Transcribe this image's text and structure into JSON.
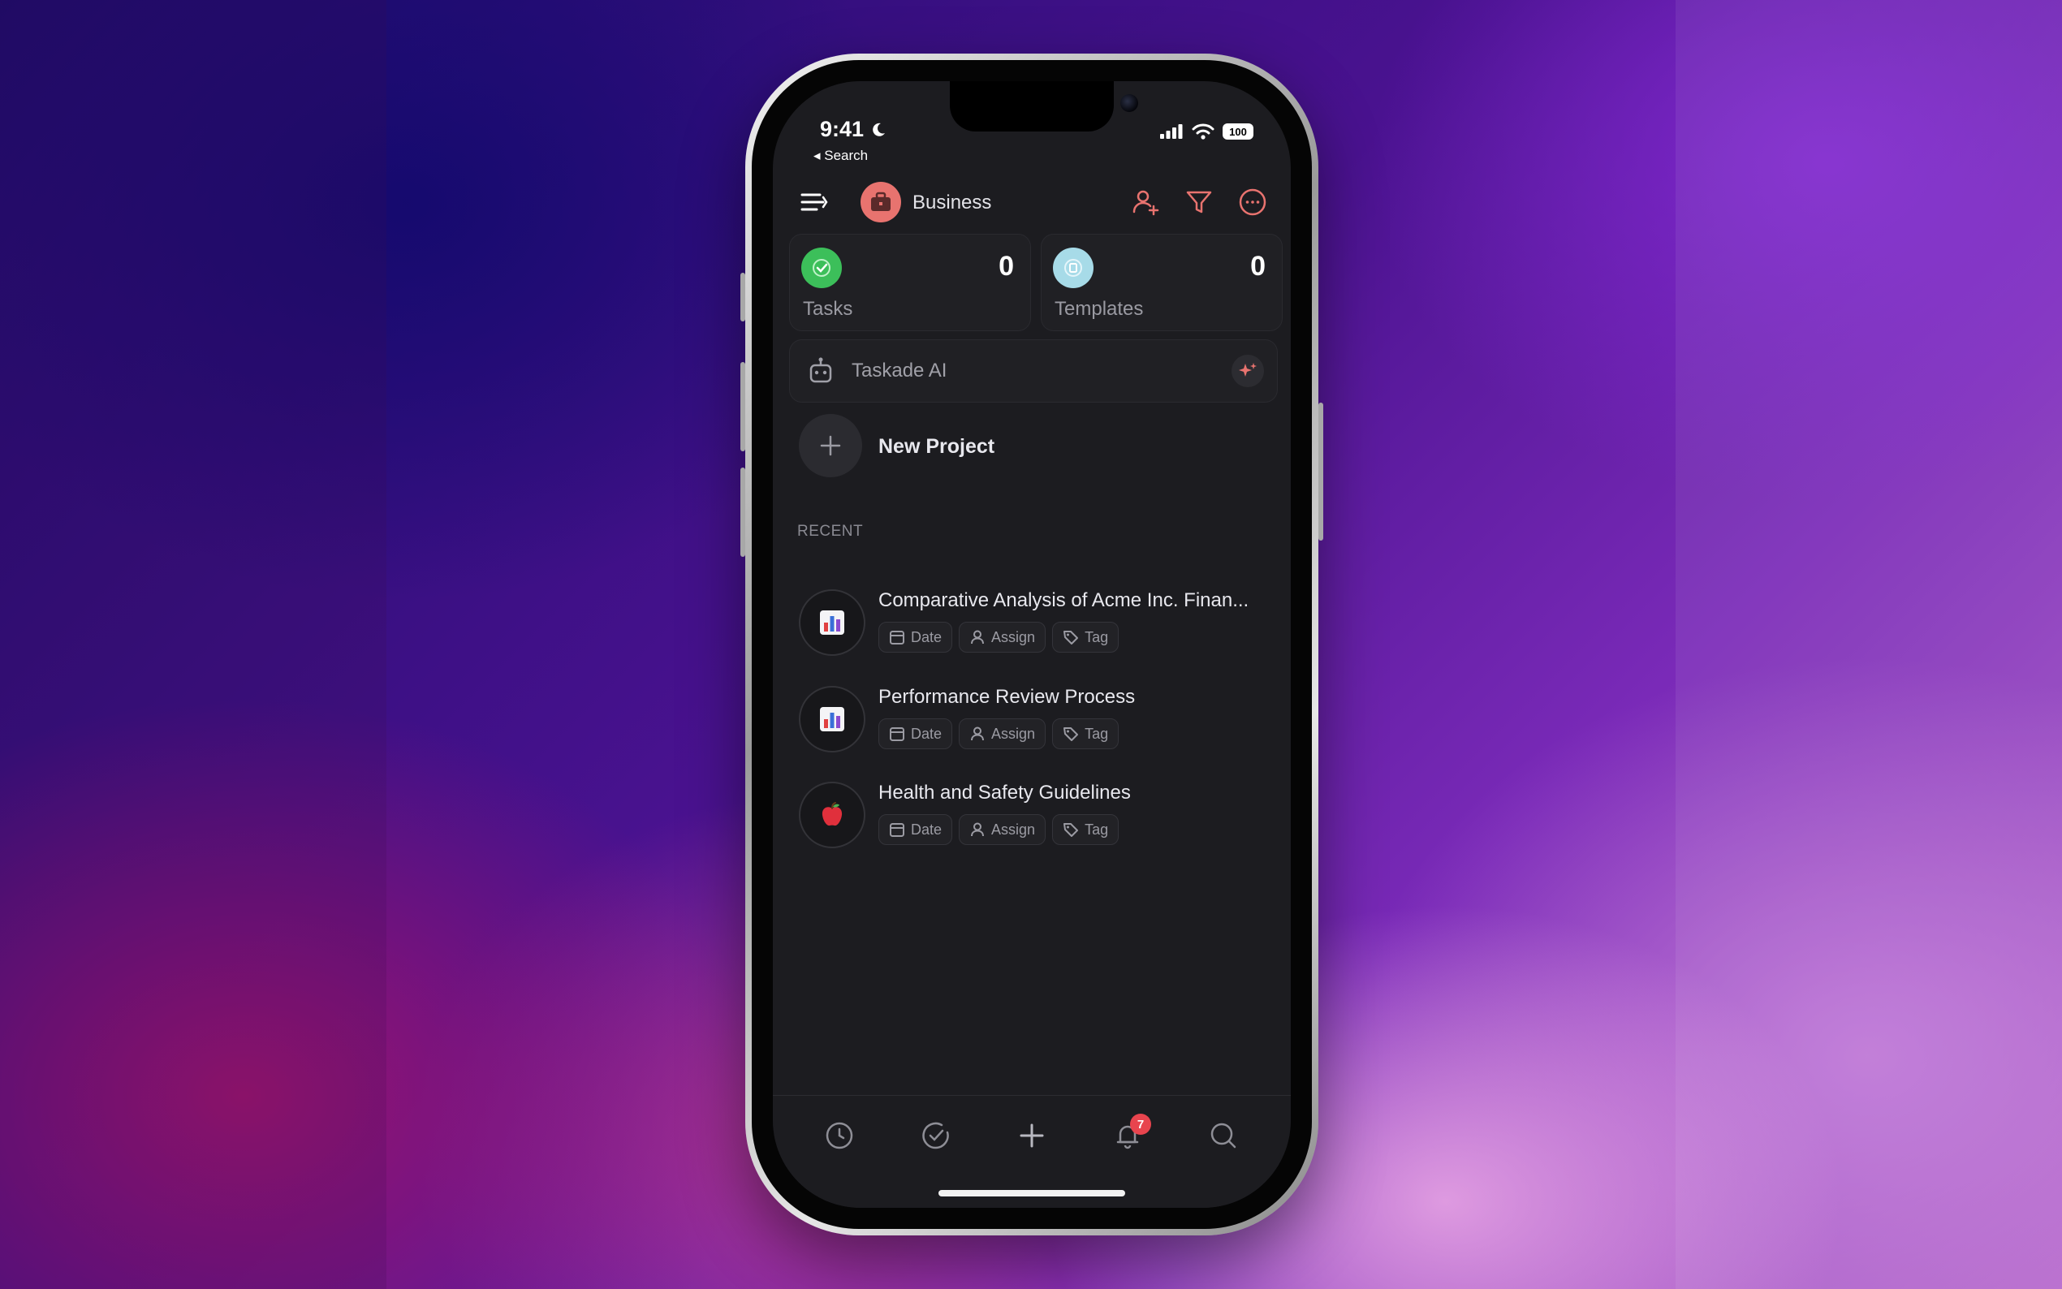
{
  "status": {
    "time": "9:41",
    "back": "◂ Search",
    "battery": "100"
  },
  "header": {
    "workspace": "Business"
  },
  "cards": [
    {
      "label": "Tasks",
      "count": "0"
    },
    {
      "label": "Templates",
      "count": "0"
    }
  ],
  "ai": {
    "label": "Taskade AI"
  },
  "new_project": {
    "label": "New Project"
  },
  "recent": {
    "heading": "RECENT",
    "items": [
      {
        "title": "Comparative Analysis of Acme Inc. Finan...",
        "icon": "bar-chart-emoji"
      },
      {
        "title": "Performance Review Process",
        "icon": "bar-chart-emoji"
      },
      {
        "title": "Health and Safety Guidelines",
        "icon": "apple-emoji"
      }
    ]
  },
  "chips": {
    "date": "Date",
    "assign": "Assign",
    "tag": "Tag"
  },
  "tabbar": {
    "notifications_badge": "7"
  },
  "colors": {
    "accent": "#e8736f",
    "tasks": "#3cbf5a",
    "templates": "#a7dbe8",
    "badge": "#e8444e"
  }
}
